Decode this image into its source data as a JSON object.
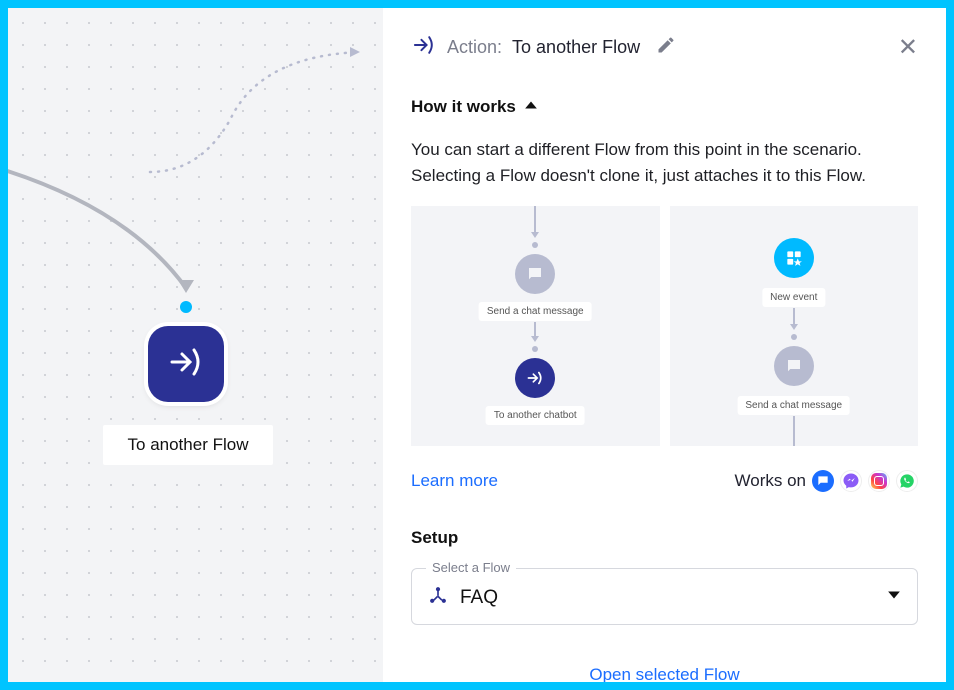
{
  "header": {
    "action_prefix": "Action:",
    "action_title": "To another Flow"
  },
  "how_it_works": {
    "label": "How it works",
    "expanded": true,
    "description": "You can start a different Flow from this point in the scenario. Selecting a Flow doesn't clone it, just attaches it to this Flow."
  },
  "diagram": {
    "left": {
      "chat_label": "Send a chat message",
      "to_chatbot_label": "To another chatbot"
    },
    "right": {
      "new_event_label": "New event",
      "chat_label": "Send a chat message"
    }
  },
  "learn_more": "Learn more",
  "works_on": {
    "label": "Works on",
    "channels": [
      "chat",
      "messenger",
      "instagram",
      "whatsapp"
    ]
  },
  "setup": {
    "label": "Setup",
    "select_label": "Select a Flow",
    "selected_value": "FAQ"
  },
  "open_flow": "Open selected Flow",
  "canvas": {
    "node_label": "To another Flow"
  }
}
